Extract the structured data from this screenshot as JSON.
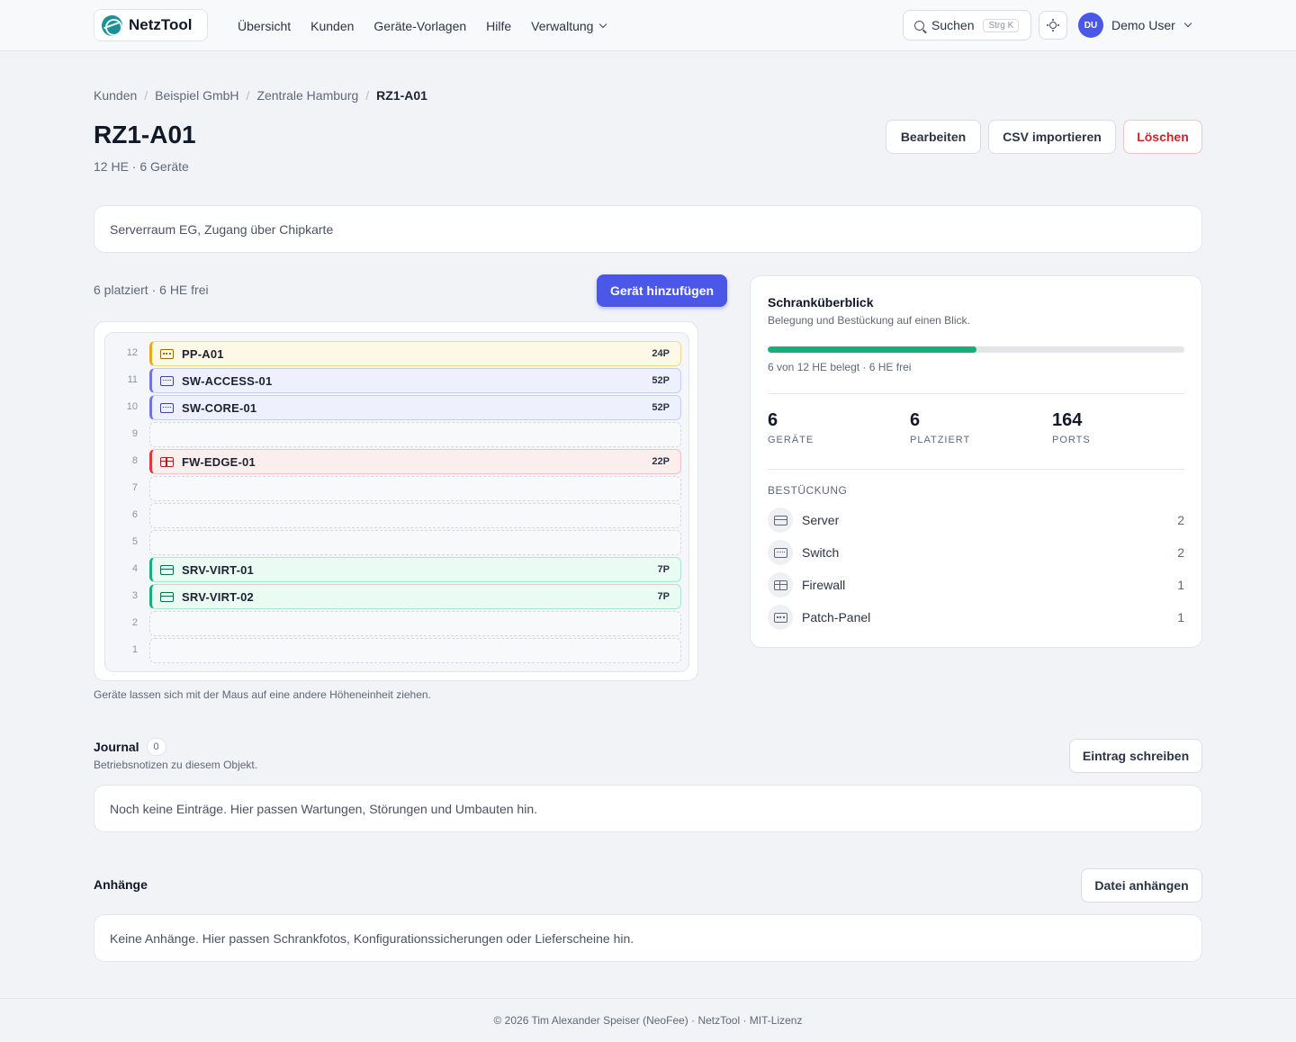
{
  "app": {
    "name": "NetzTool"
  },
  "nav": [
    {
      "label": "Übersicht"
    },
    {
      "label": "Kunden"
    },
    {
      "label": "Geräte-Vorlagen"
    },
    {
      "label": "Hilfe"
    },
    {
      "label": "Verwaltung"
    }
  ],
  "search": {
    "label": "Suchen",
    "shortcut": "Strg K"
  },
  "user": {
    "initials": "DU",
    "name": "Demo User"
  },
  "breadcrumb": [
    "Kunden",
    "Beispiel GmbH",
    "Zentrale Hamburg",
    "RZ1-A01"
  ],
  "rack": {
    "title": "RZ1-A01",
    "subtitle": "12 HE · 6 Geräte",
    "description": "Serverraum EG, Zugang über Chipkarte",
    "placement_summary": "6 platziert · 6 HE frei",
    "hint": "Geräte lassen sich mit der Maus auf eine andere Höheneinheit ziehen.",
    "units": [
      {
        "num": "12",
        "device": {
          "name": "PP-A01",
          "ports": "24P",
          "type": "patch-panel",
          "icon": "patch-panel-icon"
        }
      },
      {
        "num": "11",
        "device": {
          "name": "SW-ACCESS-01",
          "ports": "52P",
          "type": "switch",
          "icon": "switch-icon"
        }
      },
      {
        "num": "10",
        "device": {
          "name": "SW-CORE-01",
          "ports": "52P",
          "type": "switch",
          "icon": "switch-icon"
        }
      },
      {
        "num": "9",
        "device": null
      },
      {
        "num": "8",
        "device": {
          "name": "FW-EDGE-01",
          "ports": "22P",
          "type": "firewall",
          "icon": "firewall-icon"
        }
      },
      {
        "num": "7",
        "device": null
      },
      {
        "num": "6",
        "device": null
      },
      {
        "num": "5",
        "device": null
      },
      {
        "num": "4",
        "device": {
          "name": "SRV-VIRT-01",
          "ports": "7P",
          "type": "server",
          "icon": "server-icon"
        }
      },
      {
        "num": "3",
        "device": {
          "name": "SRV-VIRT-02",
          "ports": "7P",
          "type": "server",
          "icon": "server-icon"
        }
      },
      {
        "num": "2",
        "device": null
      },
      {
        "num": "1",
        "device": null
      }
    ]
  },
  "actions": {
    "edit": "Bearbeiten",
    "import_csv": "CSV importieren",
    "delete": "Löschen",
    "add_device": "Gerät hinzufügen"
  },
  "overview": {
    "title": "Schranküberblick",
    "subtitle": "Belegung und Bestückung auf einen Blick.",
    "occupancy_fraction": 0.5,
    "occupancy_text": "6 von 12 HE belegt · 6 HE frei",
    "stats": [
      {
        "value": "6",
        "label": "GERÄTE"
      },
      {
        "value": "6",
        "label": "PLATZIERT"
      },
      {
        "value": "164",
        "label": "PORTS"
      }
    ],
    "equipment_heading": "BESTÜCKUNG",
    "equipment": [
      {
        "label": "Server",
        "count": "2",
        "icon": "server-icon"
      },
      {
        "label": "Switch",
        "count": "2",
        "icon": "switch-icon"
      },
      {
        "label": "Firewall",
        "count": "1",
        "icon": "firewall-icon"
      },
      {
        "label": "Patch-Panel",
        "count": "1",
        "icon": "patch-panel-icon"
      }
    ]
  },
  "journal": {
    "title": "Journal",
    "count": "0",
    "subtitle": "Betriebsnotizen zu diesem Objekt.",
    "button": "Eintrag schreiben",
    "empty": "Noch keine Einträge. Hier passen Wartungen, Störungen und Umbauten hin."
  },
  "attachments": {
    "title": "Anhänge",
    "button": "Datei anhängen",
    "empty": "Keine Anhänge. Hier passen Schrankfotos, Konfigurationssicherungen oder Lieferscheine hin."
  },
  "footer": {
    "text": "© 2026 Tim Alexander Speiser (NeoFee) · NetzTool · MIT-Lizenz"
  },
  "colors": {
    "accent": "#4b57e6",
    "patch-panel": {
      "bg": "#fff8e6",
      "border": "#f6d98a",
      "edge": "#eaa91a",
      "icon": "#9a6a08"
    },
    "switch": {
      "bg": "#eef1fd",
      "border": "#c6cdf5",
      "edge": "#6b76e8",
      "icon": "#3d4699"
    },
    "firewall": {
      "bg": "#fdeeee",
      "border": "#f3c2c2",
      "edge": "#dc3b3b",
      "icon": "#a12727"
    },
    "server": {
      "bg": "#e9fbf3",
      "border": "#a8ead0",
      "edge": "#16b07a",
      "icon": "#0b6e4b"
    }
  }
}
